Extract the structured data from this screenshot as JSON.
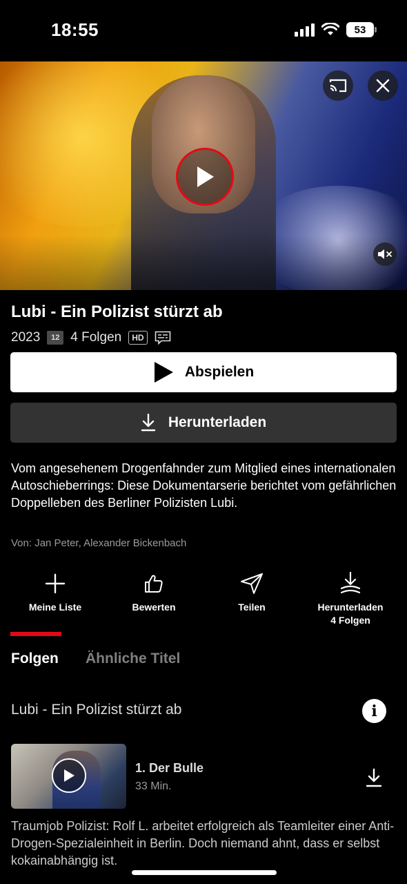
{
  "status_bar": {
    "time": "18:55",
    "battery": "53"
  },
  "hero": {
    "icons": {
      "cast": "cast-icon",
      "close": "close-icon",
      "play": "play-icon",
      "mute": "mute-icon"
    }
  },
  "show": {
    "title": "Lubi - Ein Polizist stürzt ab",
    "year": "2023",
    "age_rating": "12",
    "episodes_count": "4 Folgen",
    "quality_badge": "HD",
    "subtitle_icon": "subtitles-icon"
  },
  "buttons": {
    "play_label": "Abspielen",
    "download_label": "Herunterladen"
  },
  "description": "Vom angesehenem Drogenfahnder zum Mitglied eines internationalen Autoschieberrings: Diese Dokumentarserie berichtet vom gefährlichen Doppelleben des Berliner Polizisten Lubi.",
  "credits": "Von: Jan Peter, Alexander Bickenbach",
  "actions": [
    {
      "label": "Meine Liste",
      "icon": "plus-icon"
    },
    {
      "label": "Bewerten",
      "icon": "thumbs-up-icon"
    },
    {
      "label": "Teilen",
      "icon": "send-icon"
    },
    {
      "label": "Herunterladen\n4 Folgen",
      "line1": "Herunterladen",
      "line2": "4 Folgen",
      "icon": "download-all-icon"
    }
  ],
  "tabs": [
    {
      "label": "Folgen",
      "active": true
    },
    {
      "label": "Ähnliche Titel",
      "active": false
    }
  ],
  "season": {
    "title": "Lubi - Ein Polizist stürzt ab"
  },
  "episodes": [
    {
      "title": "1. Der Bulle",
      "duration": "33 Min.",
      "description": "Traumjob Polizist: Rolf L. arbeitet erfolgreich als Teamleiter einer Anti-Drogen-Spezialeinheit in Berlin. Doch niemand ahnt, dass er selbst kokainabhängig ist."
    }
  ],
  "colors": {
    "accent": "#e50914",
    "background": "#000000",
    "secondary_button": "#333333"
  }
}
